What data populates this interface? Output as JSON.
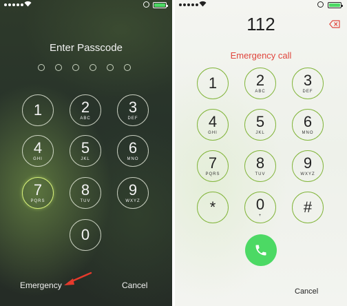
{
  "lock_screen": {
    "title": "Enter Passcode",
    "passcode_dot_count": 6,
    "keys": [
      {
        "digit": "1",
        "letters": ""
      },
      {
        "digit": "2",
        "letters": "ABC"
      },
      {
        "digit": "3",
        "letters": "DEF"
      },
      {
        "digit": "4",
        "letters": "GHI"
      },
      {
        "digit": "5",
        "letters": "JKL"
      },
      {
        "digit": "6",
        "letters": "MNO"
      },
      {
        "digit": "7",
        "letters": "PQRS"
      },
      {
        "digit": "8",
        "letters": "TUV"
      },
      {
        "digit": "9",
        "letters": "WXYZ"
      },
      {
        "digit": "0",
        "letters": ""
      }
    ],
    "emergency_label": "Emergency",
    "cancel_label": "Cancel",
    "annotation_arrow_color": "#e53a2c"
  },
  "emergency_dialer": {
    "dialed_number": "112",
    "status_label": "Emergency call",
    "keys": [
      {
        "digit": "1",
        "letters": ""
      },
      {
        "digit": "2",
        "letters": "ABC"
      },
      {
        "digit": "3",
        "letters": "DEF"
      },
      {
        "digit": "4",
        "letters": "GHI"
      },
      {
        "digit": "5",
        "letters": "JKL"
      },
      {
        "digit": "6",
        "letters": "MNO"
      },
      {
        "digit": "7",
        "letters": "PQRS"
      },
      {
        "digit": "8",
        "letters": "TUV"
      },
      {
        "digit": "9",
        "letters": "WXYZ"
      },
      {
        "digit": "*",
        "letters": ""
      },
      {
        "digit": "0",
        "letters": "+"
      },
      {
        "digit": "#",
        "letters": ""
      }
    ],
    "cancel_label": "Cancel",
    "call_button_color": "#4cd964",
    "key_ring_color": "#82b53b",
    "status_color": "#e0463d"
  },
  "status_bar": {
    "icons": [
      "signal-dots-icon",
      "wifi-icon",
      "orientation-lock-icon",
      "battery-icon"
    ],
    "battery_level": 1.0,
    "battery_color": "#4cd964"
  }
}
